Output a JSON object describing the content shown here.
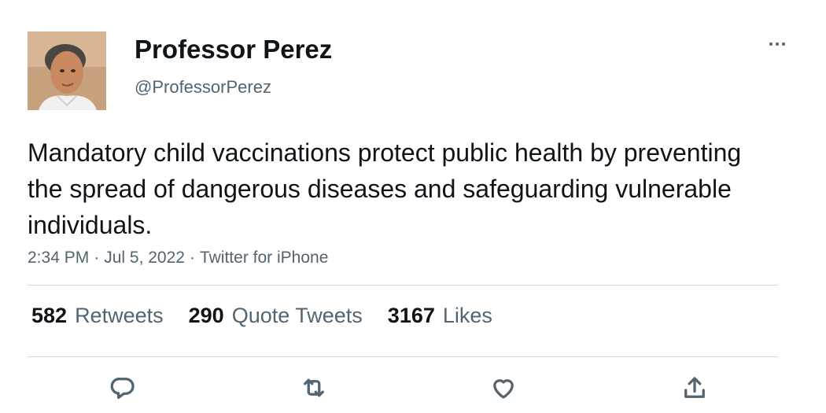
{
  "author": {
    "display_name": "Professor Perez",
    "handle": "@ProfessorPerez"
  },
  "tweet": {
    "text": "Mandatory child vaccinations protect public health by preventing the spread of dangerous diseases and safeguarding vulnerable individuals.",
    "time": "2:34 PM",
    "date": "Jul 5, 2022",
    "separator": "·",
    "source": "Twitter for iPhone"
  },
  "stats": [
    {
      "count": "582",
      "label": "Retweets"
    },
    {
      "count": "290",
      "label": "Quote Tweets"
    },
    {
      "count": "3167",
      "label": "Likes"
    }
  ],
  "icons": {
    "more": "more-horizontal-icon",
    "reply": "reply-bubble-icon",
    "retweet": "retweet-arrows-icon",
    "like": "heart-icon",
    "share": "share-upload-icon"
  },
  "colors": {
    "text": "#0f1419",
    "secondary": "#536471",
    "divider": "#cfd9de",
    "background": "#ffffff"
  }
}
